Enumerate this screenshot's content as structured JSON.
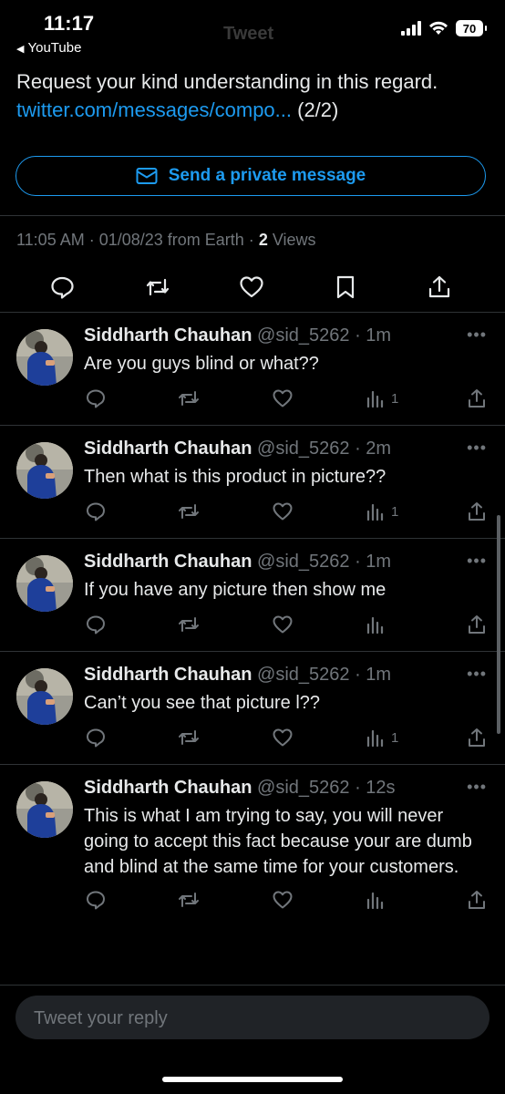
{
  "status_bar": {
    "time": "11:17",
    "back_app": "YouTube",
    "ghost_title": "Tweet",
    "battery": "70"
  },
  "tweet": {
    "line1": "Request your kind understanding in this regard.",
    "link_text": "twitter.com/messages/compo...",
    "thread_marker": "(2/2)",
    "dm_button_label": "Send a private message",
    "timestamp": "11:05 AM · 01/08/23 from Earth ·",
    "views_count": "2",
    "views_label": "Views"
  },
  "replies": [
    {
      "name": "Siddharth Chauhan",
      "handle": "@sid_5262",
      "time": "· 1m",
      "text": "Are you guys blind or what??",
      "views": "1"
    },
    {
      "name": "Siddharth Chauhan",
      "handle": "@sid_5262",
      "time": "· 2m",
      "text": "Then what is this product in picture??",
      "views": "1"
    },
    {
      "name": "Siddharth Chauhan",
      "handle": "@sid_5262",
      "time": "· 1m",
      "text": "If you have any picture then show me",
      "views": ""
    },
    {
      "name": "Siddharth Chauhan",
      "handle": "@sid_5262",
      "time": "· 1m",
      "text": "Can’t you see that picture l??",
      "views": "1"
    },
    {
      "name": "Siddharth Chauhan",
      "handle": "@sid_5262",
      "time": "· 12s",
      "text": "This is what I am trying to say, you will never going to accept this fact because your are dumb and blind at the same time for your customers.",
      "views": ""
    }
  ],
  "reply_box": {
    "placeholder": "Tweet your reply"
  },
  "colors": {
    "accent": "#1d9bf0",
    "background": "#000000",
    "muted": "#71767b"
  }
}
